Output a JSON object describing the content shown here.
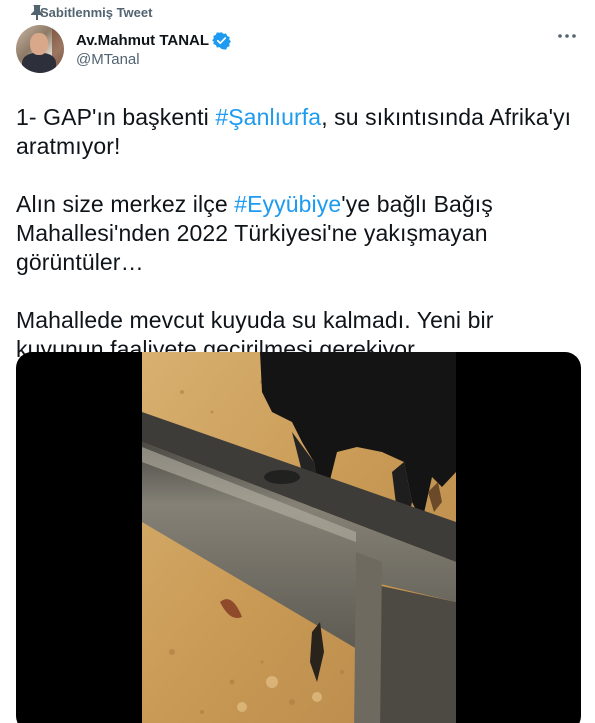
{
  "pinned": {
    "label": "Sabitlenmiş Tweet",
    "icon": "pin-icon"
  },
  "author": {
    "display_name": "Av.Mahmut TANAL",
    "handle": "@MTanal",
    "verified": true,
    "verified_color": "#1d9bf0",
    "avatar_icon": "avatar"
  },
  "more_icon": "more-icon",
  "tweet": {
    "p1": {
      "before": "1- GAP'ın başkenti ",
      "hashtag": "#Şanlıurfa",
      "after": ", su sıkıntısında Afrika'yı aratmıyor!"
    },
    "p2": {
      "before": "Alın size merkez ilçe ",
      "hashtag": "#Eyyübiye",
      "after": "'ye bağlı Bağış Mahallesi'nden 2022 Türkiyesi'ne yakışmayan görüntüler…"
    },
    "p3": {
      "text": "Mahallede mevcut kuyuda su kalmadı. Yeni bir kuyunun faaliyete geçirilmesi gerekiyor."
    },
    "hashtag_color": "#1d9bf0"
  },
  "media": {
    "type": "video",
    "scene": "video-still"
  }
}
